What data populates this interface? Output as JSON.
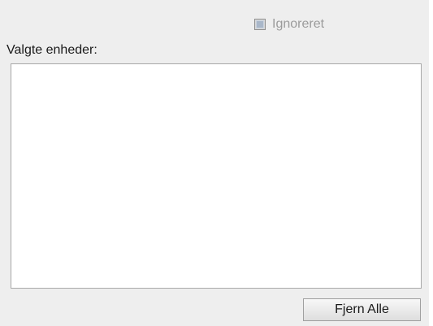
{
  "ignored_checkbox": {
    "label": "Ignoreret",
    "checked": false,
    "enabled": false
  },
  "selected_units": {
    "label": "Valgte enheder:",
    "items": []
  },
  "actions": {
    "remove_all_label": "Fjern Alle"
  }
}
